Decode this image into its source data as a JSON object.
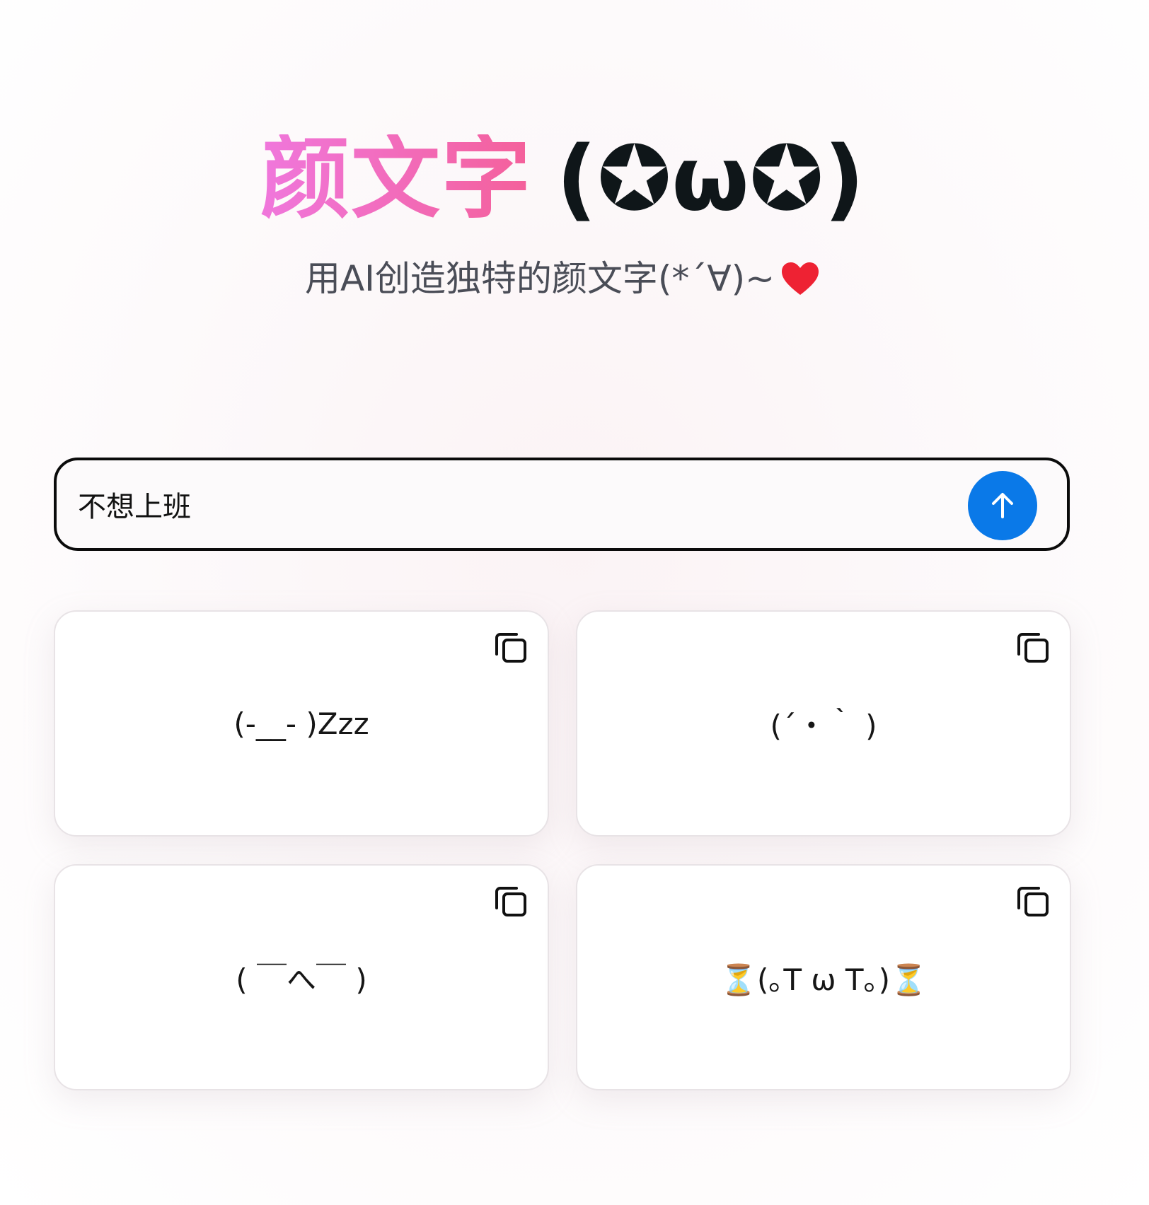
{
  "header": {
    "title_text": "颜文字",
    "title_kaomoji": "(✪ω✪)",
    "subtitle": "用AI创造独特的颜文字(*´∀)~"
  },
  "search": {
    "value": "不想上班"
  },
  "icons": {
    "heart": "heart-icon",
    "send": "arrow-up-icon",
    "copy": "copy-icon"
  },
  "colors": {
    "title_gradient_start": "#f077dc",
    "title_gradient_end": "#f4609a",
    "send_button": "#0a79e8",
    "heart": "#ee2233"
  },
  "results": [
    {
      "text": "(-__- )Zzz"
    },
    {
      "text": "(´・｀ )"
    },
    {
      "text": "( ￣へ￣ )"
    },
    {
      "text": "⏳(｡T ω T｡)⏳"
    }
  ]
}
